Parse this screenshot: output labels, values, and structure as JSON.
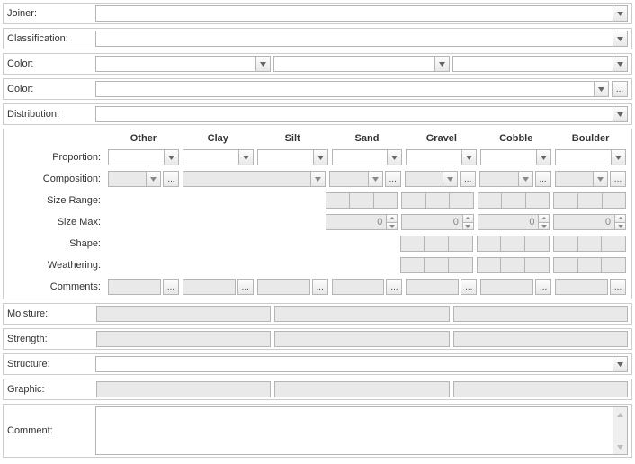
{
  "labels": {
    "joiner": "Joiner:",
    "classification": "Classification:",
    "color1": "Color:",
    "color2": "Color:",
    "distribution": "Distribution:",
    "moisture": "Moisture:",
    "strength": "Strength:",
    "structure": "Structure:",
    "graphic": "Graphic:",
    "comment": "Comment:",
    "ellipsis": "..."
  },
  "grid": {
    "headers": [
      "Other",
      "Clay",
      "Silt",
      "Sand",
      "Gravel",
      "Cobble",
      "Boulder"
    ],
    "rows": {
      "proportion": "Proportion:",
      "composition": "Composition:",
      "sizeRange": "Size Range:",
      "sizeMax": "Size Max:",
      "shape": "Shape:",
      "weathering": "Weathering:",
      "comments": "Comments:"
    },
    "sizeMaxValues": [
      "0",
      "0",
      "0",
      "0"
    ]
  }
}
